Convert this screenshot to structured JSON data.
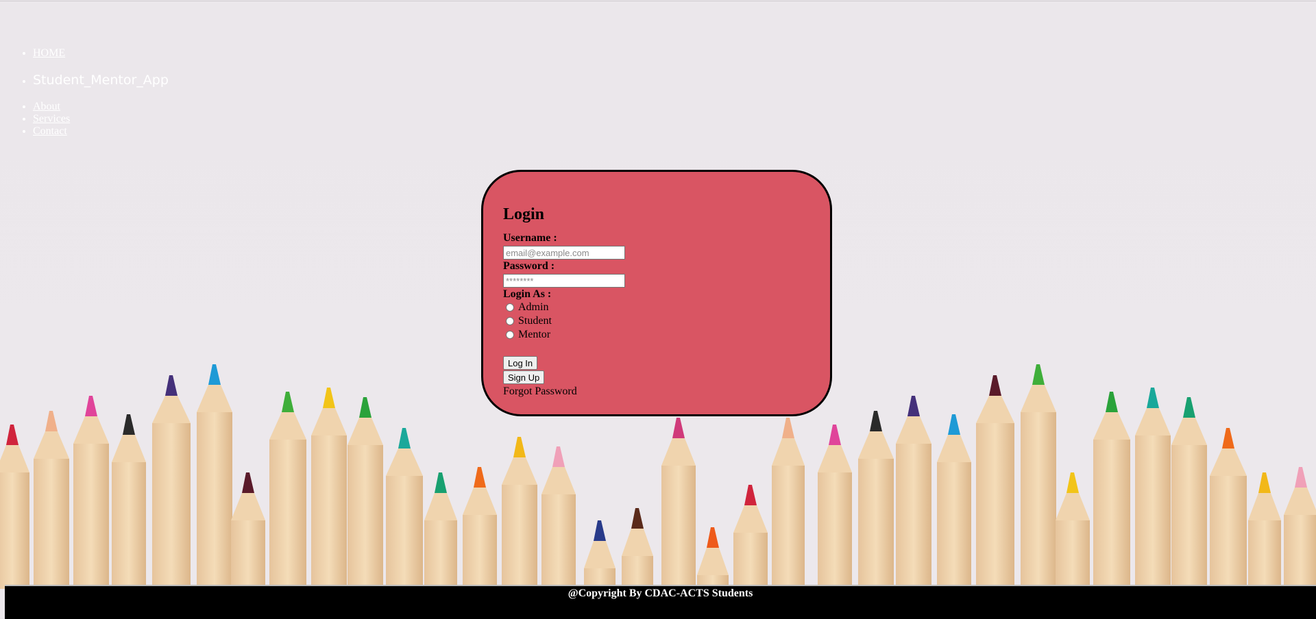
{
  "nav": {
    "home_label": "HOME",
    "brand": "Student_Mentor_App",
    "links": [
      "About",
      "Services",
      "Contact"
    ]
  },
  "login": {
    "title": "Login",
    "username_label": "Username :",
    "username_placeholder": "email@example.com",
    "password_label": "Password :",
    "password_value": "********",
    "role_label": "Login As :",
    "roles": [
      "Admin",
      "Student",
      "Mentor"
    ],
    "login_button": "Log In",
    "signup_button": "Sign Up",
    "forgot_link": "Forgot Password"
  },
  "footer": {
    "text": "@Copyright By CDAC-ACTS Students"
  },
  "colors": {
    "card_background": "#d95563",
    "footer_background": "#000000",
    "page_background": "#e8e4e8"
  }
}
